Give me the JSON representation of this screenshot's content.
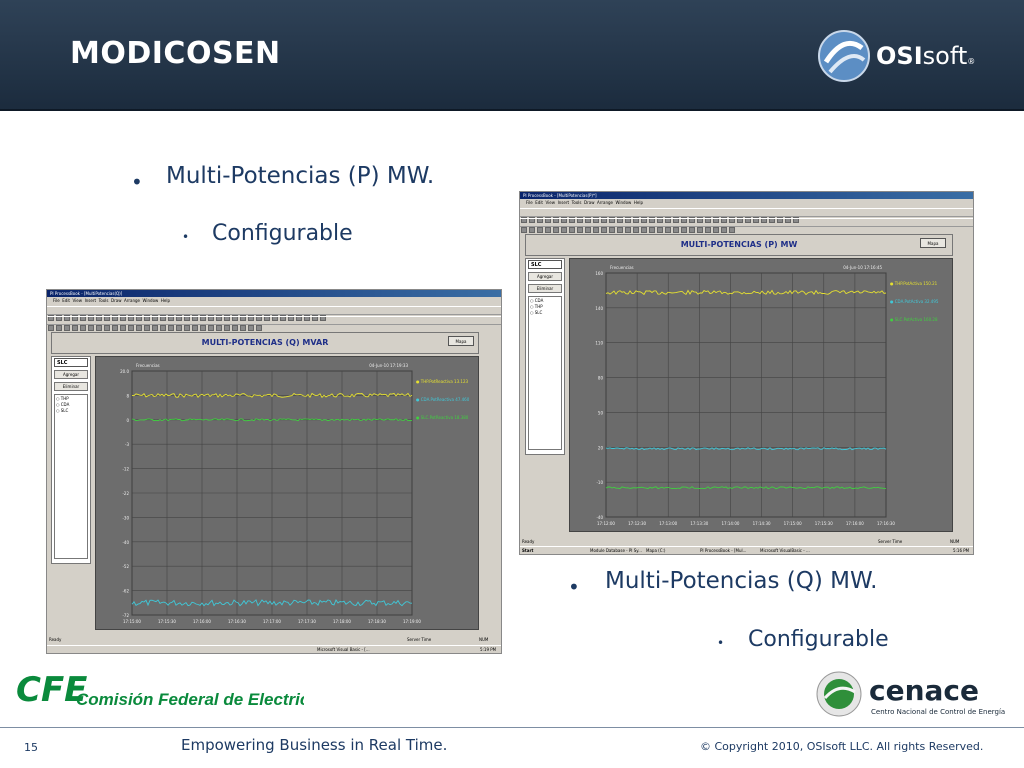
{
  "header": {
    "title": "MODICOSEN",
    "logo_brand": "OSIsoft",
    "logo_strong": "OSI",
    "logo_light": "soft",
    "logo_reg": "®"
  },
  "bullets": {
    "b1": "Multi-Potencias (P) MW.",
    "b1_sub": "Configurable",
    "b2": "Multi-Potencias (Q) MW.",
    "b2_sub": "Configurable"
  },
  "screenshot_q": {
    "window_title": "PI ProcessBook - [MultiPotencias(Q)]",
    "menu": [
      "File",
      "Edit",
      "View",
      "Insert",
      "Tools",
      "Draw",
      "Arrange",
      "Window",
      "Help"
    ],
    "zoom": "100%",
    "panel_title": "MULTI-POTENCIAS (Q) MVAR",
    "mapa_button": "Mapa",
    "selector": "SLC",
    "agregar": "Agregar",
    "eliminar": "Eliminar",
    "list": [
      "THP",
      "CDA",
      "SLC"
    ],
    "trend_label": "Frecuencias",
    "trend_time": "04-Jun-10 17:19:33",
    "yticks": [
      "20.0",
      "8",
      "0",
      "-3",
      "-12",
      "-22",
      "-30",
      "-40",
      "-52",
      "-62",
      "-72"
    ],
    "xticks": [
      "17:15:00",
      "17:15:30",
      "17:16:00",
      "17:16:30",
      "17:17:00",
      "17:17:30",
      "17:18:00",
      "17:18:30",
      "17:19:00"
    ],
    "legend": [
      "THP.PotReactiva 13.123",
      "CDA.PotReactiva 47.460",
      "SLC.PotReactiva 18.380"
    ],
    "legend_colors": [
      "#e5e030",
      "#40c8d8",
      "#40d040"
    ],
    "status_left": "Ready",
    "status_server": "Server Time",
    "status_num": "NUM",
    "task_items": [
      "MultiPotencias/Visual Basic - [...",
      "Microsoft Visual Basic - [..."
    ],
    "clock": "5:19 PM"
  },
  "screenshot_p": {
    "window_title": "PI ProcessBook - [MultiPotencias(P)*]",
    "menu": [
      "File",
      "Edit",
      "View",
      "Insert",
      "Tools",
      "Draw",
      "Arrange",
      "Window",
      "Help"
    ],
    "zoom": "100%",
    "panel_title": "MULTI-POTENCIAS (P) MW",
    "mapa_button": "Mapa",
    "selector": "SLC",
    "agregar": "Agregar",
    "eliminar": "Eliminar",
    "list": [
      "CDA",
      "THP",
      "SLC"
    ],
    "trend_label": "Frecuencias",
    "trend_time": "04-Jun-10 17:16:45",
    "yticks": [
      "160",
      "140",
      "110",
      "80",
      "50",
      "20",
      "-10",
      "-40"
    ],
    "xticks": [
      "17:12:00",
      "17:12:30",
      "17:13:00",
      "17:13:30",
      "17:14:00",
      "17:14:30",
      "17:15:00",
      "17:15:30",
      "17:16:00",
      "17:16:30"
    ],
    "legend": [
      "THP.PotActiva 150.21",
      "CDA.PotActiva 32.495",
      "SLC.PotActiva 160.28"
    ],
    "legend_colors": [
      "#e5e030",
      "#40c8d8",
      "#40d040"
    ],
    "status_left": "Ready",
    "status_server": "Server Time",
    "status_num": "NUM",
    "task_items": [
      "Start",
      "Module Database - PI Sy...",
      "Mapa (C:)",
      "PI ProcessBook - [Mul...",
      "Microsoft VisualBasic - ..."
    ],
    "clock": "5:16 PM"
  },
  "footer": {
    "page_number": "15",
    "tagline": "Empowering Business in Real Time.",
    "copyright": "© Copyright 2010, OSIsoft LLC.  All rights Reserved.",
    "cfe_short": "CFE",
    "cfe_name": "Comisión Federal de Electricidad",
    "cenace_name": "cenace",
    "cenace_full": "Centro Nacional de Control de Energía"
  },
  "colors": {
    "header_bg": "#243447",
    "text_blue": "#1d3a63",
    "cfe_green": "#0a8a3c",
    "cenace_dark": "#1a2a3a"
  }
}
